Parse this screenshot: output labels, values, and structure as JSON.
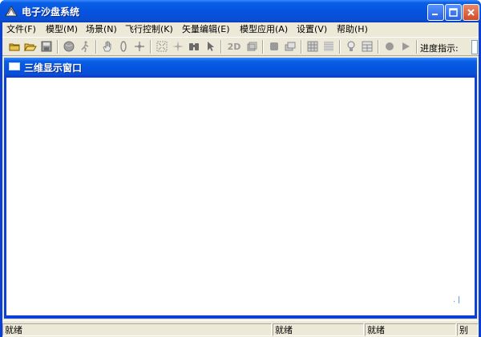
{
  "window": {
    "title": "电子沙盘系统"
  },
  "menu": {
    "items": [
      {
        "label": "文件(F)"
      },
      {
        "label": "模型(M)"
      },
      {
        "label": "场景(N)"
      },
      {
        "label": "飞行控制(K)"
      },
      {
        "label": "矢量编辑(E)"
      },
      {
        "label": "模型应用(A)"
      },
      {
        "label": "设置(V)"
      },
      {
        "label": "帮助(H)"
      }
    ]
  },
  "toolbar": {
    "tools": [
      "new-icon",
      "open-icon",
      "save-icon",
      "globe-icon",
      "walk-icon",
      "pan-hand-icon",
      "rotate-icon",
      "move-icon",
      "zoom-extent-icon",
      "compass-icon",
      "binoculars-icon",
      "pointer-icon",
      "2d-icon",
      "3d-layer-icon",
      "layer-icon",
      "layers-icon",
      "grid-icon",
      "texture-icon",
      "bulb-icon",
      "table-icon",
      "record-icon",
      "play-icon"
    ],
    "btn_2d": "2D",
    "progress_label": "进度指示:"
  },
  "child_window": {
    "title": "三维显示窗口"
  },
  "statusbar": {
    "pane1": "就绪",
    "pane2": "就绪",
    "pane3": "就绪",
    "pane4": "别"
  },
  "colors": {
    "titlebar": "#0554e0",
    "client": "#ece9d8",
    "view": "#ffffff"
  }
}
